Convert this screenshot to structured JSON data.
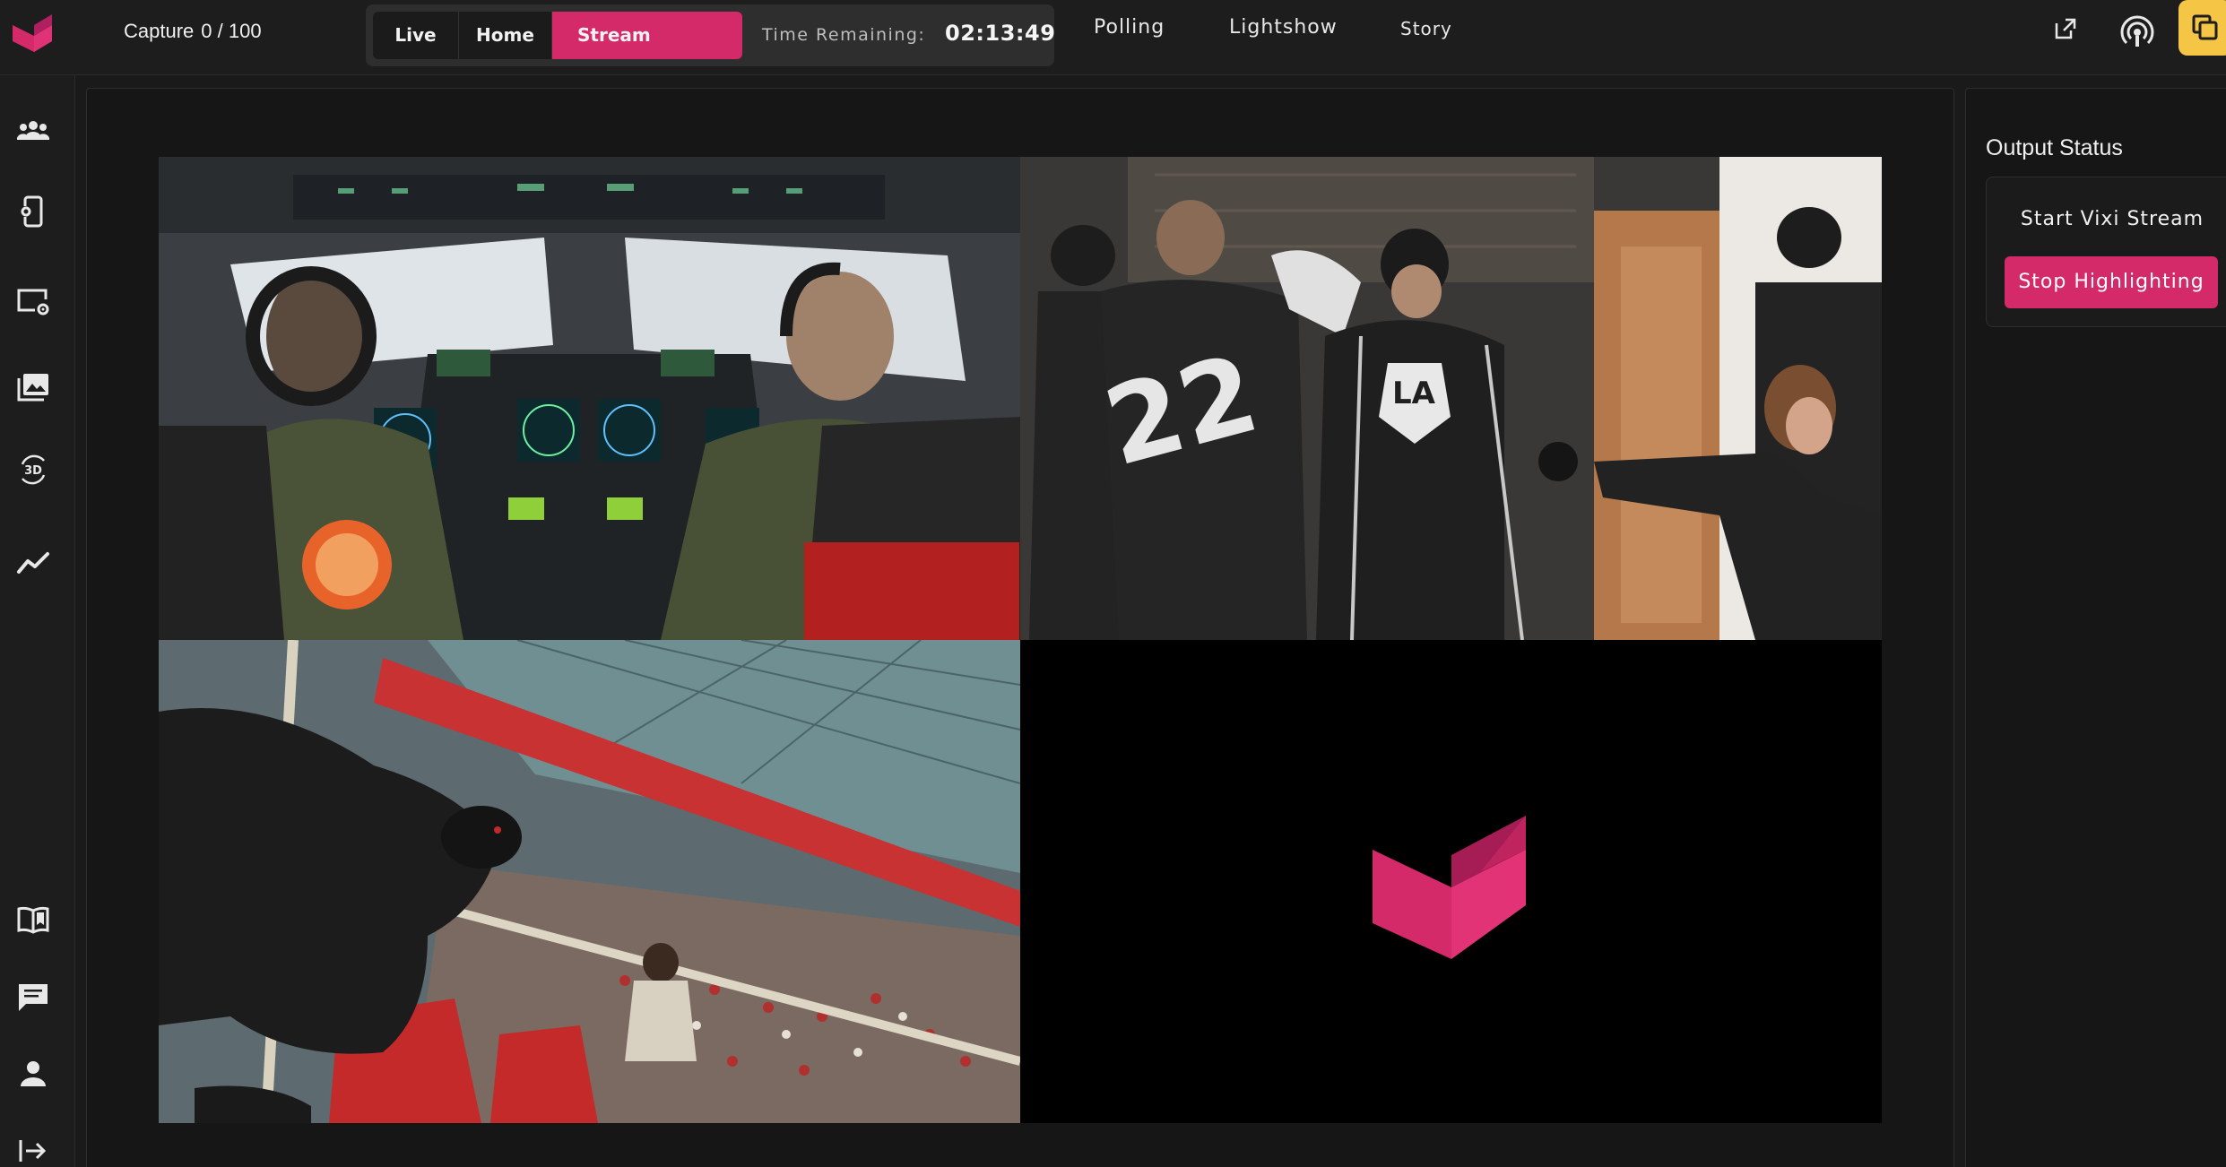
{
  "header": {
    "capture_label": "Capture",
    "capture_count": "0 / 100",
    "modes": [
      {
        "label": "Live"
      },
      {
        "label": "Home"
      },
      {
        "label": "Stream",
        "active": true
      }
    ],
    "time_remaining_label": "Time Remaining:",
    "time_remaining_value": "02:13:49",
    "nav": [
      {
        "label": "Polling"
      },
      {
        "label": "Lightshow"
      },
      {
        "label": "Story"
      }
    ],
    "icons": [
      "external-link-icon",
      "podcast-icon",
      "layers-icon"
    ]
  },
  "sidebar": {
    "top_icons": [
      "users-icon",
      "phone-settings-icon",
      "display-settings-icon",
      "photo-library-icon",
      "3d-rotation-icon",
      "analytics-icon"
    ],
    "bottom_icons": [
      "book-icon",
      "chat-icon",
      "person-icon",
      "logout-icon"
    ]
  },
  "video_grid": {
    "tiles": [
      {
        "content": "cockpit video feed"
      },
      {
        "content": "hockey players video feed"
      },
      {
        "content": "arena crowd video feed"
      },
      {
        "content": "vixi logo placeholder"
      }
    ]
  },
  "output_status": {
    "title": "Output Status",
    "start_button": "Start Vixi Stream",
    "stop_button": "Stop Highlighting"
  },
  "colors": {
    "accent": "#d42a6a",
    "highlight": "#f5c545",
    "background": "#1a1a1a"
  }
}
